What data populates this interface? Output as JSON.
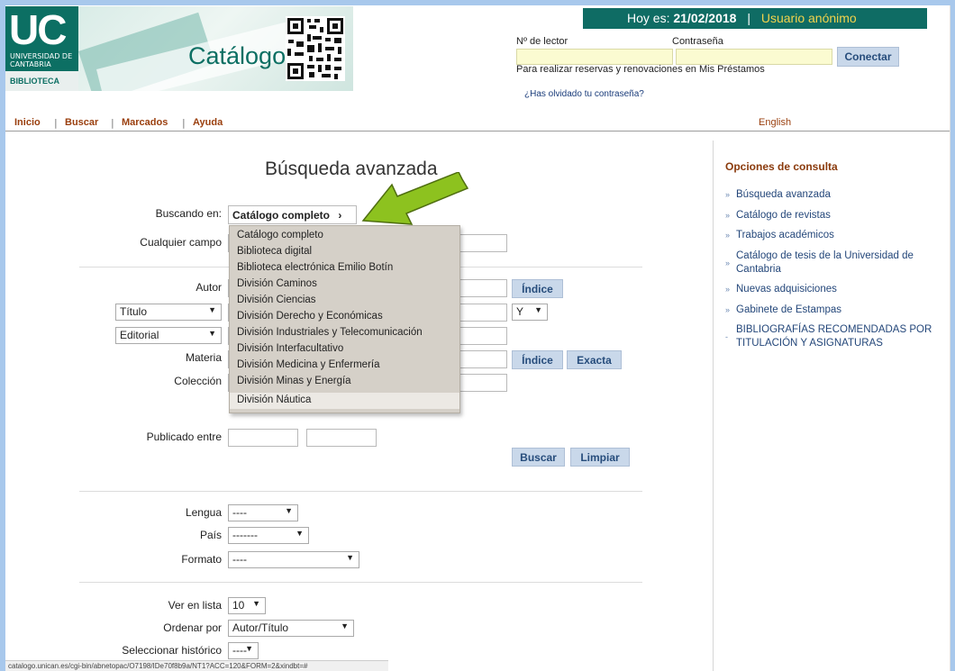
{
  "header": {
    "logo_uc": "UC",
    "logo_university": "UNIVERSIDAD DE CANTABRIA",
    "logo_library": "BIBLIOTECA",
    "catalog_title": "Catálogo",
    "date_label": "Hoy es:",
    "date_value": "21/02/2018",
    "user_status": "Usuario anónimo",
    "reader_label": "Nº de lector",
    "password_label": "Contraseña",
    "connect_button": "Conectar",
    "reserve_text": "Para realizar reservas y renovaciones en Mis Préstamos",
    "forgot_link": "¿Has olvidado tu contraseña?"
  },
  "menu": {
    "items": [
      "Inicio",
      "Buscar",
      "Marcados",
      "Ayuda"
    ],
    "language_link": "English"
  },
  "form": {
    "title": "Búsqueda avanzada",
    "searching_in_label": "Buscando en:",
    "scope_value": "Catálogo completo",
    "any_field_label": "Cualquier campo",
    "author_label": "Autor",
    "title_select": "Título",
    "operator_select": "Y",
    "publisher_select": "Editorial",
    "subject_label": "Materia",
    "collection_label": "Colección",
    "index_button": "Índice",
    "exact_button": "Exacta",
    "published_label": "Publicado entre",
    "search_button": "Buscar",
    "clear_button": "Limpiar",
    "language_label": "Lengua",
    "language_value": "----",
    "country_label": "País",
    "country_value": "-------",
    "format_label": "Formato",
    "format_value": "----",
    "list_label": "Ver en lista",
    "list_value": "10",
    "sort_label": "Ordenar por",
    "sort_value": "Autor/Título",
    "history_label": "Seleccionar histórico",
    "history_value": "----"
  },
  "dropdown": {
    "options": [
      "Catálogo completo",
      "Biblioteca digital",
      "Biblioteca electrónica Emilio Botín",
      "División Caminos",
      "División Ciencias",
      "División Derecho y Económicas",
      "División Industriales y Telecomunicación",
      "División Interfacultativo",
      "División Medicina y Enfermería",
      "División Minas y Energía",
      "División Náutica"
    ]
  },
  "sidebar": {
    "title": "Opciones de consulta",
    "items": [
      "Búsqueda avanzada",
      "Catálogo de revistas",
      "Trabajos académicos",
      "Catálogo de tesis de la Universidad de Cantabria",
      "Nuevas adquisiciones",
      "Gabinete de Estampas",
      "BIBLIOGRAFÍAS RECOMENDADAS POR TITULACIÓN Y ASIGNATURAS"
    ]
  },
  "status_bar": {
    "url": "catalogo.unican.es/cgi-bin/abnetopac/O7198/IDe70f8b9a/NT1?ACC=120&FORM=2&xindbt=#"
  },
  "colors": {
    "brand_green": "#0c6f63",
    "menu_link": "#9a3f0e",
    "sidebar_link": "#24477a",
    "button_bg": "#c9d8ea",
    "arrow_green": "#8dc21f"
  }
}
